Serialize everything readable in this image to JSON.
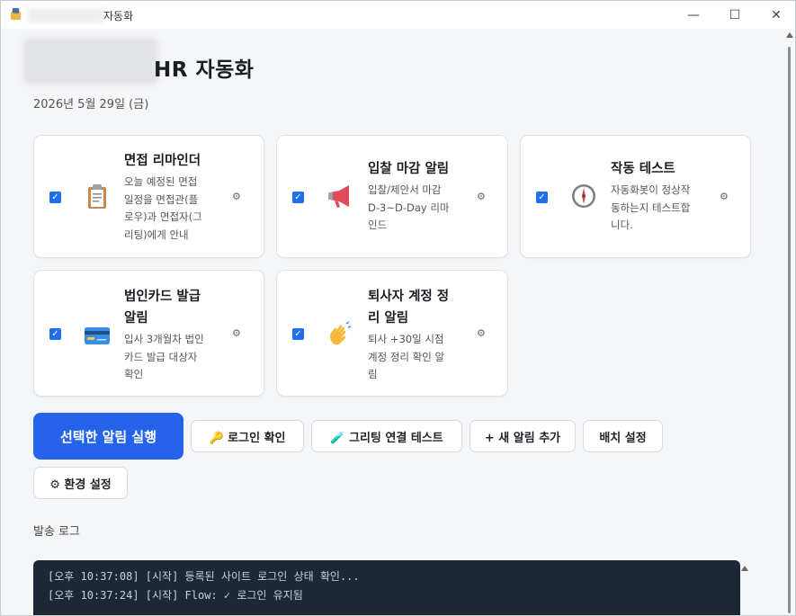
{
  "window": {
    "title": "자동화",
    "minimize_glyph": "—",
    "maximize_glyph": "☐",
    "close_glyph": "✕"
  },
  "header": {
    "title": "HR 자동화",
    "date": "2026년 5월 29일 (금)"
  },
  "cards": [
    {
      "title_line1": "면접 리마인더",
      "title_line2": "",
      "desc": [
        "오늘 예정된 면접",
        "일정을 면접관(플",
        "로우)과 면접자(그",
        "리팅)에게 안내"
      ],
      "checked": true,
      "icon": "clipboard-icon",
      "gear": "⚙"
    },
    {
      "title_line1": "입찰 마감 알림",
      "title_line2": "",
      "desc": [
        "입찰/제안서 마감",
        "D-3~D-Day 리마",
        "인드"
      ],
      "checked": true,
      "icon": "megaphone-icon",
      "gear": "⚙"
    },
    {
      "title_line1": "작동 테스트",
      "title_line2": "",
      "desc": [
        "자동화봇이 정상작",
        "동하는지 테스트합",
        "니다."
      ],
      "checked": true,
      "icon": "compass-icon",
      "gear": "⚙"
    },
    {
      "title_line1": "법인카드 발급",
      "title_line2": "알림",
      "desc": [
        "입사 3개월차 법인",
        "카드 발급 대상자",
        "확인"
      ],
      "checked": true,
      "icon": "credit-card-icon",
      "gear": "⚙"
    },
    {
      "title_line1": "퇴사자 계정 정",
      "title_line2": "리 알림",
      "desc": [
        "퇴사 +30일 시점",
        "계정 정리 확인 알",
        "림"
      ],
      "checked": true,
      "icon": "waving-hand-icon",
      "gear": "⚙"
    }
  ],
  "buttons": {
    "run": "선택한 알림 실행",
    "login_check": "🔑 로그인 확인",
    "greeting_test": "🧪 그리팅 연결 테스트",
    "add_alert": "+ 새 알림 추가",
    "batch": "배치 설정",
    "env": "⚙ 환경 설정"
  },
  "log": {
    "label": "발송 로그",
    "lines": [
      "[오후 10:37:08] [시작] 등록된 사이트 로그인 상태 확인...",
      "[오후 10:37:24] [시작] Flow: ✓ 로그인 유지됨"
    ]
  },
  "colors": {
    "primary": "#2563eb",
    "log_bg": "#1e2736"
  }
}
